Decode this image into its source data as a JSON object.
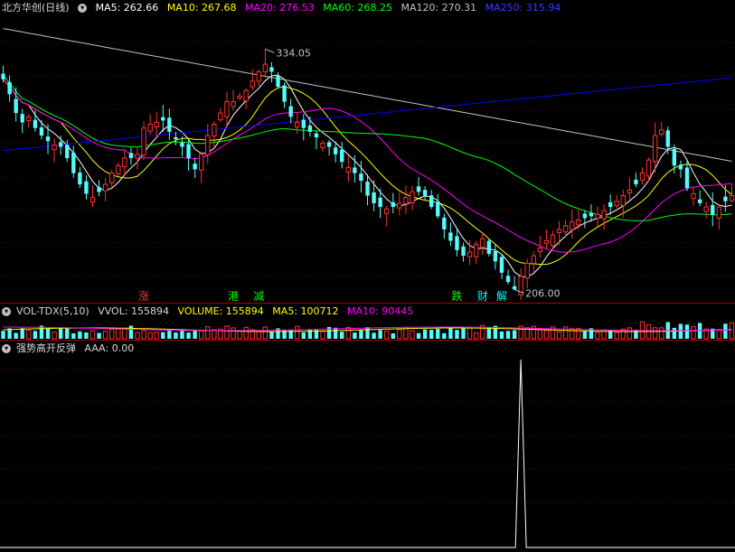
{
  "colors": {
    "up": "#ff3232",
    "down": "#54fcfc",
    "grid": "#6b0000",
    "ma5": "#ffffff",
    "ma10": "#ffff00",
    "ma20": "#ff00ff",
    "ma60": "#00ff00",
    "ma120": "#c0c0c0",
    "ma250": "#0000ff",
    "spike": "#ffffff"
  },
  "main_header": {
    "title": "北方华创(日线)",
    "ma5": "MA5: 262.66",
    "ma10": "MA10: 267.68",
    "ma20": "MA20: 276.53",
    "ma60": "MA60: 268.25",
    "ma120": "MA120: 270.31",
    "ma250": "MA250: 315.94"
  },
  "vol_header": {
    "title": "VOL-TDX(5,10)",
    "vvol": "VVOL: 155894",
    "volume": "VOLUME: 155894",
    "ma5": "MA5: 100712",
    "ma10": "MA10: 90445"
  },
  "ind_header": {
    "title": "强势高开反弹",
    "aaa": "AAA: 0.00"
  },
  "chart_data": [
    {
      "type": "candlestick",
      "title": "北方华创(日线)",
      "y_range": [
        200,
        352
      ],
      "annotations": [
        {
          "label": "334.05",
          "kind": "high",
          "index": 41
        },
        {
          "label": "206.00",
          "kind": "low",
          "index": 99
        }
      ],
      "markers": [
        {
          "text": "涨",
          "index": 22,
          "color": "#ff3232"
        },
        {
          "text": "港",
          "index": 36,
          "color": "#00ff00"
        },
        {
          "text": "减",
          "index": 40,
          "color": "#00ff00"
        },
        {
          "text": "跌",
          "index": 71,
          "color": "#00ff00"
        },
        {
          "text": "财",
          "index": 75,
          "color": "#00ffff"
        },
        {
          "text": "解",
          "index": 78,
          "color": "#00ffff"
        }
      ],
      "closes": [
        318,
        310,
        300,
        295,
        298,
        292,
        288,
        285,
        283,
        282,
        276,
        268,
        262,
        257,
        255,
        258,
        262,
        268,
        272,
        276,
        276,
        278,
        292,
        294,
        295,
        296,
        290,
        286,
        282,
        276,
        270,
        278,
        288,
        294,
        300,
        306,
        306,
        309,
        312,
        317,
        322,
        326,
        322,
        314,
        306,
        298,
        295,
        292,
        290,
        287,
        284,
        282,
        278,
        274,
        271,
        268,
        264,
        256,
        252,
        250,
        249,
        250,
        252,
        255,
        258,
        258,
        256,
        250,
        245,
        238,
        232,
        227,
        224,
        226,
        230,
        233,
        225,
        221,
        215,
        210,
        206,
        213,
        220,
        224,
        228,
        232,
        235,
        238,
        240,
        242,
        243,
        244,
        245,
        246,
        248,
        250,
        253,
        256,
        259,
        262,
        268,
        275,
        288,
        291,
        282,
        272,
        270,
        260,
        257,
        252,
        250,
        246,
        250,
        253,
        256
      ]
    },
    {
      "type": "bar",
      "title": "VOL-TDX(5,10)",
      "series": [
        {
          "name": "VVOL",
          "latest": 155894
        },
        {
          "name": "MA5",
          "latest": 100712
        },
        {
          "name": "MA10",
          "latest": 90445
        }
      ]
    },
    {
      "type": "line",
      "title": "强势高开反弹",
      "series": [
        {
          "name": "AAA",
          "latest": 0.0,
          "spike_index": 81,
          "spike_value": 1
        }
      ]
    }
  ]
}
